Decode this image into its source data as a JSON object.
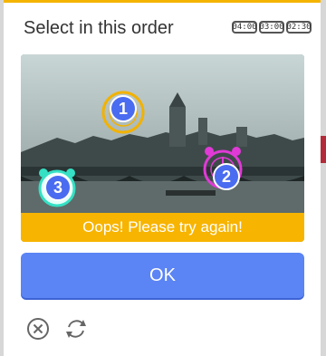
{
  "title": "Select in this order",
  "timers": [
    "04:00",
    "03:00",
    "02:30"
  ],
  "markers": [
    "1",
    "2",
    "3"
  ],
  "error_message": "Oops! Please try again!",
  "ok_label": "OK",
  "icons": {
    "close": "close-icon",
    "refresh": "refresh-icon",
    "clock": "alarm-clock-icon"
  },
  "colors": {
    "accent": "#f4b400",
    "button": "#5b84f4",
    "marker": "#4a6cf0",
    "clock_yellow": "#f2b200",
    "clock_magenta": "#e03ad6",
    "clock_teal": "#35e0c4"
  }
}
